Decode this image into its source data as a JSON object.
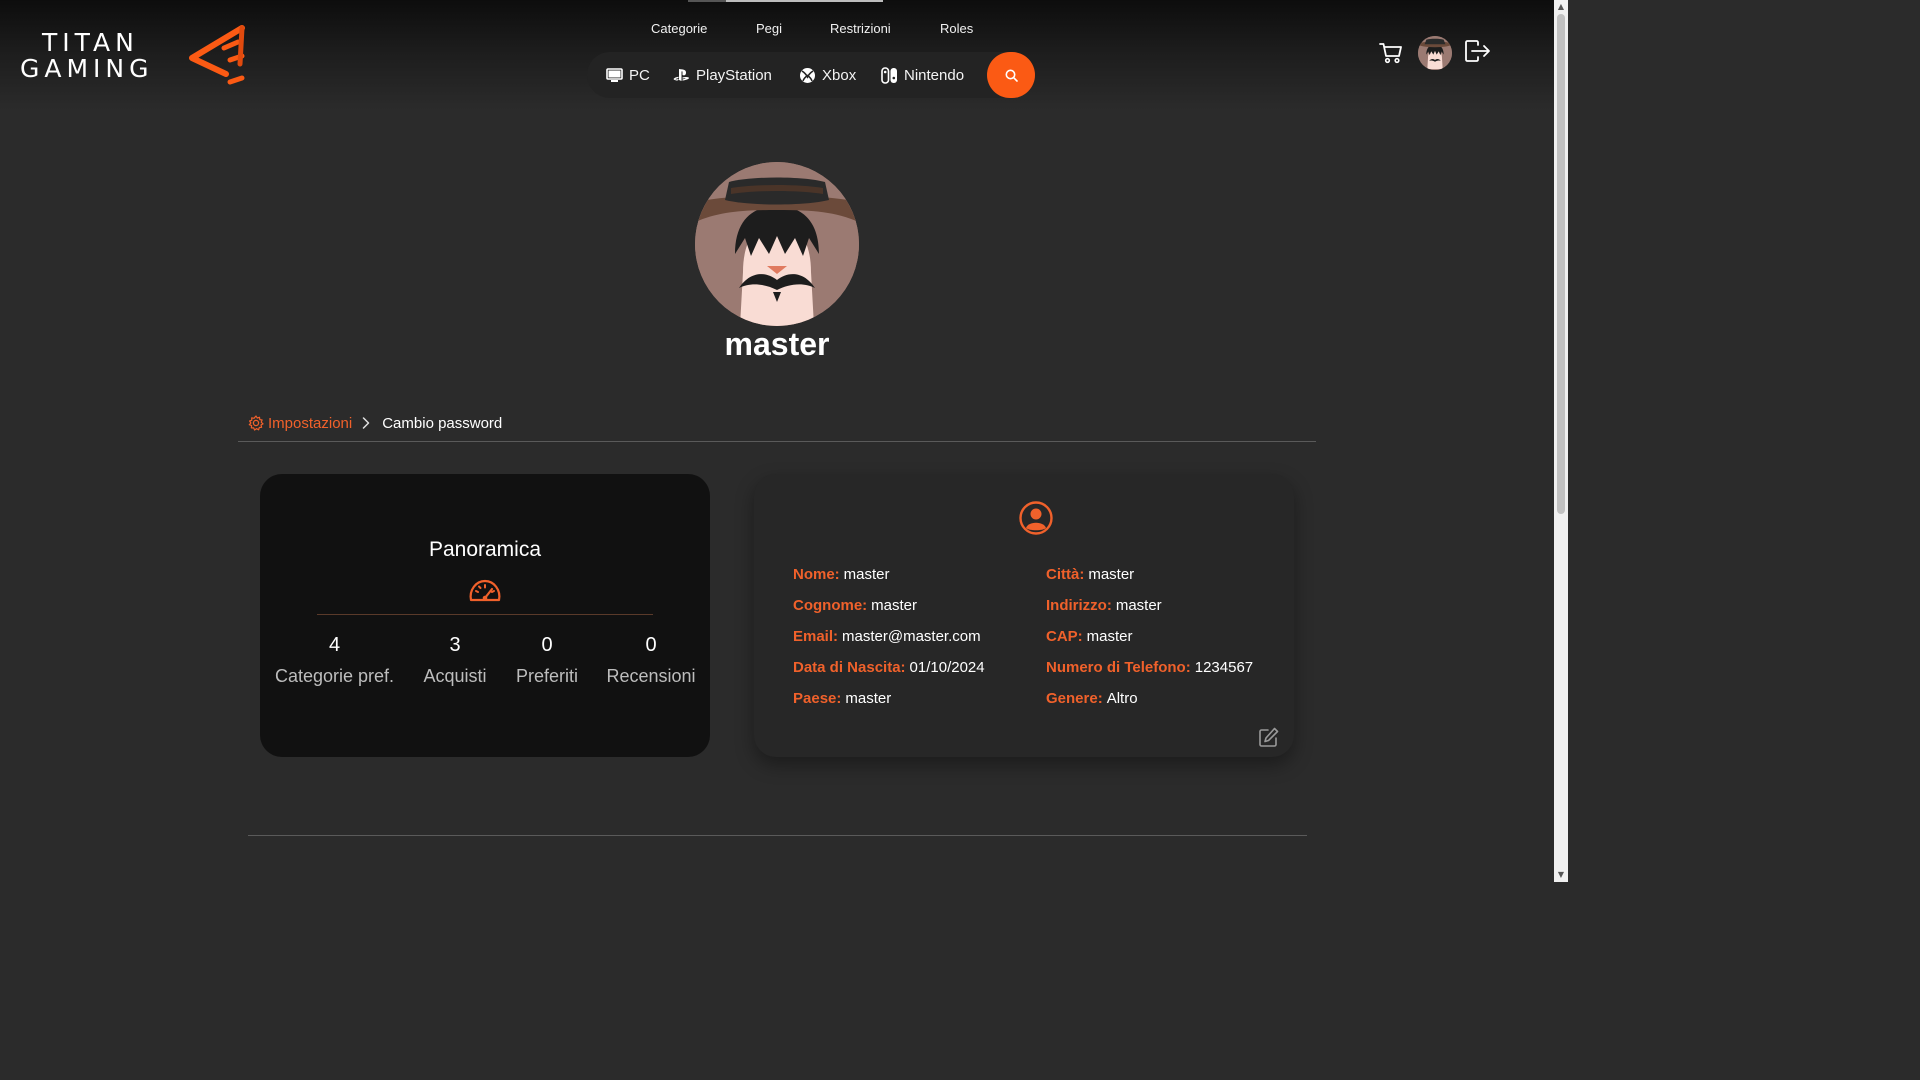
{
  "brand": {
    "line1": "TITAN",
    "line2": "GAMING",
    "accent": "#fb5a14"
  },
  "top_nav": {
    "items": [
      "Categorie",
      "Pegi",
      "Restrizioni",
      "Roles"
    ]
  },
  "platforms": [
    {
      "label": "PC",
      "icon": "monitor-icon"
    },
    {
      "label": "PlayStation",
      "icon": "playstation-icon"
    },
    {
      "label": "Xbox",
      "icon": "xbox-icon"
    },
    {
      "label": "Nintendo",
      "icon": "nintendo-switch-icon"
    }
  ],
  "header_actions": [
    "cart-icon",
    "avatar",
    "logout-icon"
  ],
  "profile": {
    "username": "master"
  },
  "breadcrumb": {
    "parent": "Impostazioni",
    "current": "Cambio password"
  },
  "overview": {
    "title": "Panoramica",
    "stats": [
      {
        "value": "4",
        "label": "Categorie pref."
      },
      {
        "value": "3",
        "label": "Acquisti"
      },
      {
        "value": "0",
        "label": "Preferiti"
      },
      {
        "value": "0",
        "label": "Recensioni"
      }
    ]
  },
  "info": {
    "left": [
      {
        "key": "Nome:",
        "value": "master"
      },
      {
        "key": "Cognome:",
        "value": "master"
      },
      {
        "key": "Email:",
        "value": "master@master.com"
      },
      {
        "key": "Data di Nascita:",
        "value": "01/10/2024"
      },
      {
        "key": "Paese:",
        "value": "master"
      }
    ],
    "right": [
      {
        "key": "Città:",
        "value": "master"
      },
      {
        "key": "Indirizzo:",
        "value": "master"
      },
      {
        "key": "CAP:",
        "value": "master"
      },
      {
        "key": "Numero di Telefono:",
        "value": "1234567"
      },
      {
        "key": "Genere:",
        "value": "Altro"
      }
    ]
  }
}
